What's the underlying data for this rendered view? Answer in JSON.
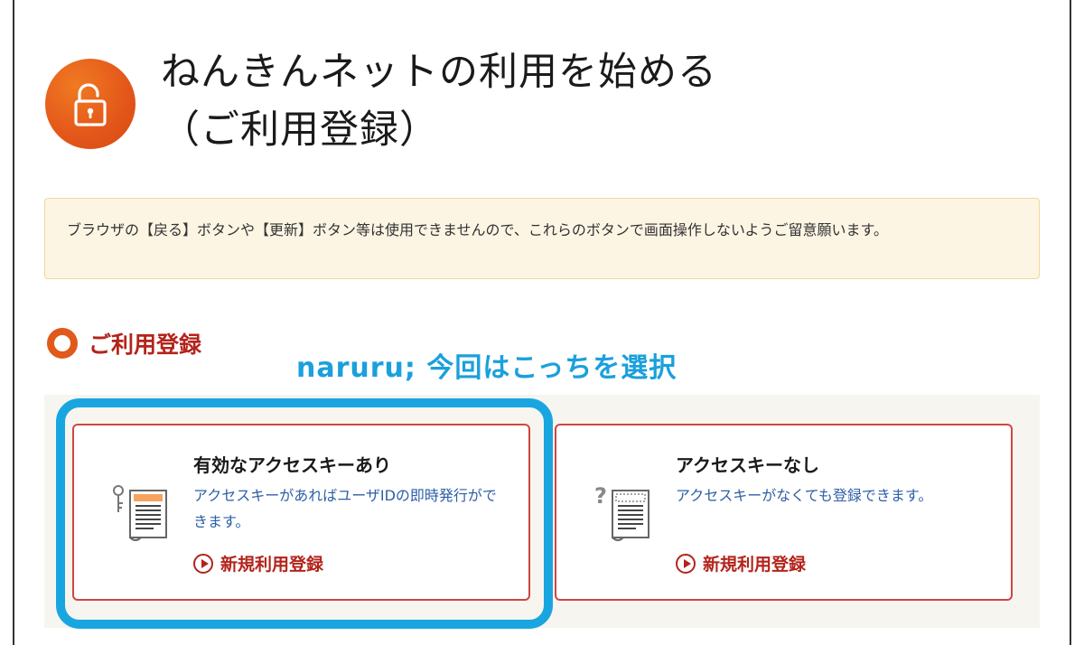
{
  "header": {
    "title": "ねんきんネットの利用を始める\n（ご利用登録）",
    "icon": "lock-icon"
  },
  "notice": {
    "text": "ブラウザの【戻る】ボタンや【更新】ボタン等は使用できませんので、これらのボタンで画面操作しないようご留意願います。"
  },
  "section": {
    "title": "ご利用登録"
  },
  "annotation": {
    "text": "naruru; 今回はこっちを選択"
  },
  "cards": [
    {
      "title": "有効なアクセスキーあり",
      "description": "アクセスキーがあればユーザIDの即時発行ができます。",
      "link": "新規利用登録",
      "icon": "key-document-icon"
    },
    {
      "title": "アクセスキーなし",
      "description": "アクセスキーがなくても登録できます。",
      "link": "新規利用登録",
      "icon": "question-document-icon"
    }
  ],
  "colors": {
    "accent_orange": "#e05a1b",
    "accent_red": "#b3241b",
    "link_blue": "#2d5fa6",
    "highlight_blue": "#19a6e0",
    "notice_bg": "#fcf5e4"
  }
}
